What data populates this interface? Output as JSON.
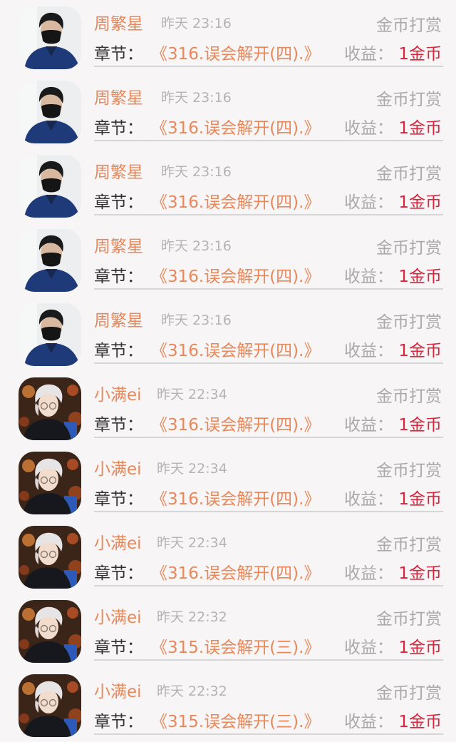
{
  "rewards": [
    {
      "name": "周繁星",
      "time": "昨天 23:16",
      "type": "金币打赏",
      "chapter_label": "章节：",
      "chapter": "《316.误会解开(四).》",
      "income_label": "收益：",
      "income": "1金币",
      "avatar": "avatar-masked-man"
    },
    {
      "name": "周繁星",
      "time": "昨天 23:16",
      "type": "金币打赏",
      "chapter_label": "章节：",
      "chapter": "《316.误会解开(四).》",
      "income_label": "收益：",
      "income": "1金币",
      "avatar": "avatar-masked-man"
    },
    {
      "name": "周繁星",
      "time": "昨天 23:16",
      "type": "金币打赏",
      "chapter_label": "章节：",
      "chapter": "《316.误会解开(四).》",
      "income_label": "收益：",
      "income": "1金币",
      "avatar": "avatar-masked-man"
    },
    {
      "name": "周繁星",
      "time": "昨天 23:16",
      "type": "金币打赏",
      "chapter_label": "章节：",
      "chapter": "《316.误会解开(四).》",
      "income_label": "收益：",
      "income": "1金币",
      "avatar": "avatar-masked-man"
    },
    {
      "name": "周繁星",
      "time": "昨天 23:16",
      "type": "金币打赏",
      "chapter_label": "章节：",
      "chapter": "《316.误会解开(四).》",
      "income_label": "收益：",
      "income": "1金币",
      "avatar": "avatar-masked-man"
    },
    {
      "name": "小满ei",
      "time": "昨天 22:34",
      "type": "金币打赏",
      "chapter_label": "章节：",
      "chapter": "《316.误会解开(四).》",
      "income_label": "收益：",
      "income": "1金币",
      "avatar": "avatar-silver-hair"
    },
    {
      "name": "小满ei",
      "time": "昨天 22:34",
      "type": "金币打赏",
      "chapter_label": "章节：",
      "chapter": "《316.误会解开(四).》",
      "income_label": "收益：",
      "income": "1金币",
      "avatar": "avatar-silver-hair"
    },
    {
      "name": "小满ei",
      "time": "昨天 22:34",
      "type": "金币打赏",
      "chapter_label": "章节：",
      "chapter": "《316.误会解开(四).》",
      "income_label": "收益：",
      "income": "1金币",
      "avatar": "avatar-silver-hair"
    },
    {
      "name": "小满ei",
      "time": "昨天 22:32",
      "type": "金币打赏",
      "chapter_label": "章节：",
      "chapter": "《315.误会解开(三).》",
      "income_label": "收益：",
      "income": "1金币",
      "avatar": "avatar-silver-hair"
    },
    {
      "name": "小满ei",
      "time": "昨天 22:32",
      "type": "金币打赏",
      "chapter_label": "章节：",
      "chapter": "《315.误会解开(三).》",
      "income_label": "收益：",
      "income": "1金币",
      "avatar": "avatar-silver-hair"
    }
  ],
  "colors": {
    "name": "#e8885a",
    "chapter": "#e8885a",
    "income": "#d7263d",
    "muted": "#aaaaaa",
    "background": "#f7f5f6"
  }
}
